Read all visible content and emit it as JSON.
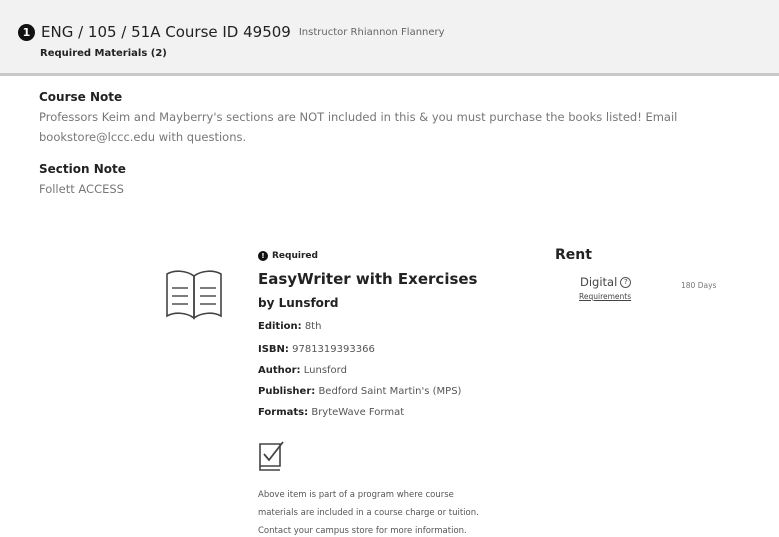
{
  "course": {
    "step_number": "1",
    "title": "ENG / 105 / 51A Course ID 49509",
    "instructor": "Instructor Rhiannon Flannery",
    "required_materials": "Required Materials (2)"
  },
  "notes": {
    "course_note_heading": "Course Note",
    "course_note_line1": "Professors Keim and Mayberry's sections are NOT included in this & you must purchase the books listed! Email",
    "course_note_line2": "bookstore@lccc.edu with questions.",
    "section_note_heading": "Section Note",
    "section_note_text": "Follett ACCESS"
  },
  "item": {
    "badge_icon": "!",
    "badge": "Required",
    "title": "EasyWriter with Exercises",
    "byline": "by Lunsford",
    "fields": [
      {
        "label": "Edition:",
        "value": "8th"
      },
      {
        "label": "ISBN:",
        "value": "9781319393366"
      },
      {
        "label": "Author:",
        "value": "Lunsford"
      },
      {
        "label": "Publisher:",
        "value": "Bedford Saint Martin's (MPS)"
      },
      {
        "label": "Formats:",
        "value": "BryteWave Format"
      }
    ],
    "program_note_lines": [
      "Above item is part of a program where course",
      "materials are included in a course charge or tuition.",
      "Contact your campus store for more information."
    ]
  },
  "rent": {
    "heading": "Rent",
    "option_label": "Digital",
    "help_glyph": "?",
    "requirements_link": "Requirements",
    "term": "180 Days"
  },
  "icons": {
    "book": "open-book-icon",
    "program": "checked-book-icon",
    "help": "help-circle-icon"
  }
}
